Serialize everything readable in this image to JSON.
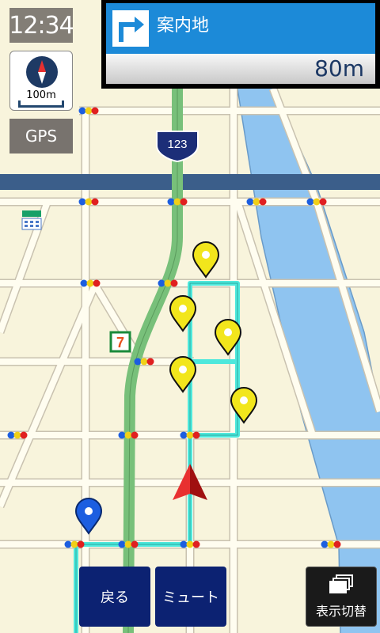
{
  "status": {
    "time": "12:34",
    "gps_label": "GPS"
  },
  "map": {
    "scale_label": "100m",
    "route_shield": "123",
    "convenience_store_mark": "7",
    "colors": {
      "background": "#f8f4dc",
      "road": "#d8d2c2",
      "river": "#8fc4f0",
      "rail": "#3b5e8a",
      "route": "#4ee8dc",
      "highway": "#78c07a",
      "pin_poi": "#f2e61c",
      "pin_user": "#1c5ee0",
      "vehicle": "#d81c1c"
    },
    "icons": [
      "compass-icon",
      "vehicle-arrow-icon",
      "route-shield-icon",
      "poi-pin-icon",
      "location-pin-icon",
      "convenience-store-icon",
      "building-icon",
      "traffic-signal-icon"
    ]
  },
  "guidance": {
    "destination": "案内地",
    "distance": "80m",
    "turn_direction": "right",
    "turn_icon": "turn-right-icon"
  },
  "buttons": {
    "back": "戻る",
    "mute": "ミュート",
    "switch_view": "表示切替",
    "switch_view_icon": "layers-icon"
  }
}
